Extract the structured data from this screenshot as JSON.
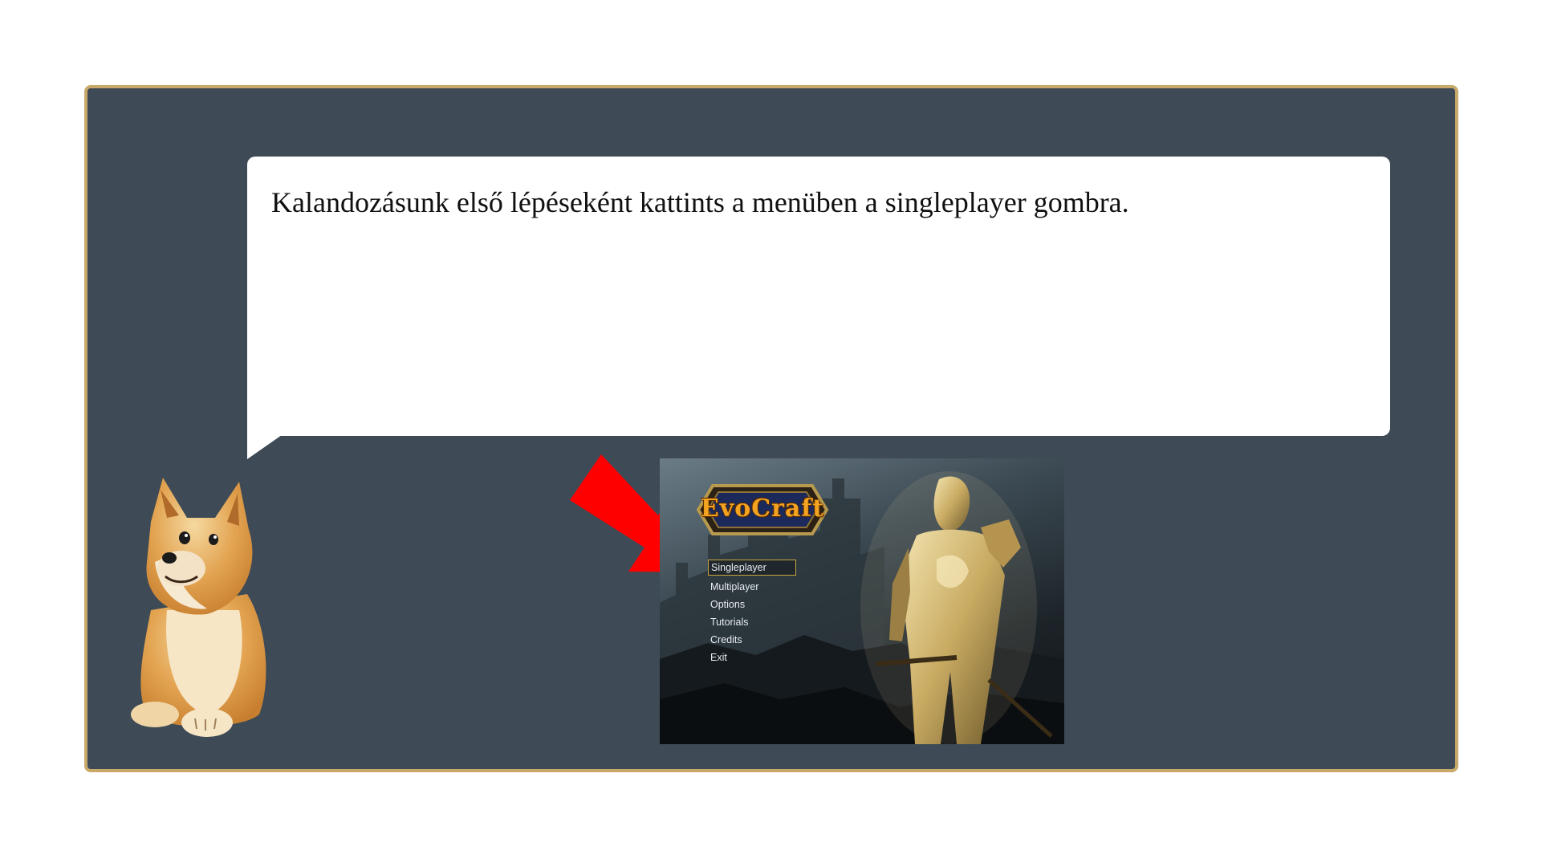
{
  "tutorial": {
    "instruction": "Kalandozásunk első lépéseként kattints a menüben a singleplayer gombra."
  },
  "game_screenshot": {
    "logo": "EvoCraft",
    "menu_items": [
      "Singleplayer",
      "Multiplayer",
      "Options",
      "Tutorials",
      "Credits",
      "Exit"
    ],
    "selected_index": 0
  },
  "colors": {
    "panel_background": "#3e4a55",
    "panel_border": "#c9a96a",
    "arrow": "#ff0000",
    "logo_text": "#f2a321"
  },
  "icons": {
    "pointer": "red-arrow-icon",
    "mascot": "doge-mascot-image"
  }
}
